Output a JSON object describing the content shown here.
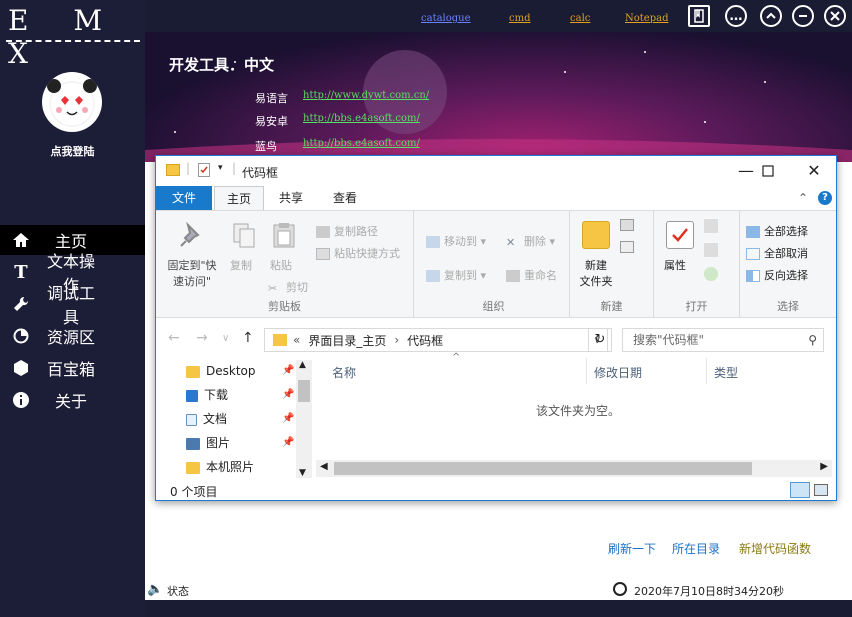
{
  "sidebar": {
    "logo": "E M X",
    "login_label": "点我登陆",
    "nav": [
      {
        "label": "主页",
        "icon": "home-icon",
        "glyph": "⌂"
      },
      {
        "label": "文本操作",
        "icon": "text-icon",
        "glyph": "T"
      },
      {
        "label": "调试工具",
        "icon": "wrench-icon",
        "glyph": "🔧"
      },
      {
        "label": "资源区",
        "icon": "pie-chart-icon",
        "glyph": "◔"
      },
      {
        "label": "百宝箱",
        "icon": "hexagon-icon",
        "glyph": "⬢"
      },
      {
        "label": "关于",
        "icon": "info-icon",
        "glyph": "i"
      }
    ]
  },
  "topbar": {
    "links": [
      "catalogue",
      "cmd",
      "calc",
      "Notepad"
    ],
    "icons": [
      "book-icon",
      "chat-icon",
      "collapse-icon",
      "minimize-icon",
      "close-icon"
    ]
  },
  "banner": {
    "title": "开发工具．中文",
    "rows": [
      {
        "label": "易语言",
        "url": "http://www.dywt.com.cn/"
      },
      {
        "label": "易安卓",
        "url": "http://bbs.e4asoft.com/"
      },
      {
        "label": "蓝鸟",
        "url": "http://bbs.e4asoft.com/"
      }
    ]
  },
  "explorer": {
    "title": "代码框",
    "tabs": [
      "文件",
      "主页",
      "共享",
      "查看"
    ],
    "ribbon": {
      "clipboard": {
        "label": "剪贴板",
        "pin": "固定到\"快速访问\"",
        "copy": "复制",
        "paste": "粘贴",
        "copy_path": "复制路径",
        "paste_shortcut": "粘贴快捷方式",
        "cut": "剪切"
      },
      "organize": {
        "label": "组织",
        "move_to": "移动到",
        "copy_to": "复制到",
        "delete": "删除",
        "rename": "重命名"
      },
      "new": {
        "label": "新建",
        "new_folder": "新建\n文件夹"
      },
      "open": {
        "label": "打开",
        "properties": "属性"
      },
      "select": {
        "label": "选择",
        "select_all": "全部选择",
        "select_none": "全部取消",
        "invert": "反向选择"
      }
    },
    "address": {
      "prefix": "«",
      "path": [
        "界面目录_主页",
        "代码框"
      ]
    },
    "search_placeholder": "搜索\"代码框\"",
    "nav_items": [
      "Desktop",
      "下载",
      "文档",
      "图片",
      "本机照片"
    ],
    "columns": [
      "名称",
      "修改日期",
      "类型"
    ],
    "empty_text": "该文件夹为空。",
    "status": "0 个项目"
  },
  "content_links": [
    "刷新一下",
    "所在目录",
    "新增代码函数"
  ],
  "footer": {
    "status": "状态",
    "datetime": "2020年7月10日8时34分20秒"
  }
}
